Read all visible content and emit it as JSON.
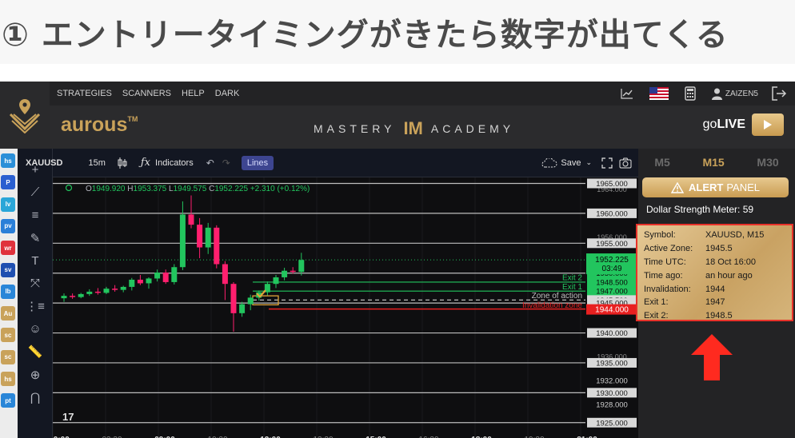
{
  "headline": {
    "text": "① エントリータイミングがきたら数字が出てくる"
  },
  "topnav": {
    "items": [
      "STRATEGIES",
      "SCANNERS",
      "HELP",
      "DARK"
    ],
    "user": "ZAIZEN5",
    "icons": [
      "line-chart-icon",
      "us-flag-icon",
      "calculator-icon",
      "user-icon",
      "logout-icon"
    ]
  },
  "brand": {
    "name": "aurous",
    "tm": "TM",
    "mastery_left": "MASTERY",
    "mastery_mid": "IM",
    "mastery_right": "ACADEMY",
    "golive_prefix": "go",
    "golive_bold": "LIVE"
  },
  "leftstrip": {
    "items": [
      {
        "label": "hs",
        "color": "#2b8fd8"
      },
      {
        "label": "P",
        "color": "#2a5fd0"
      },
      {
        "label": "lv",
        "color": "#2aa6d8"
      },
      {
        "label": "pv",
        "color": "#2a7fd8"
      },
      {
        "label": "wr",
        "color": "#e0323c"
      },
      {
        "label": "sv",
        "color": "#1f4fb0"
      },
      {
        "label": "lb",
        "color": "#2a86d8"
      },
      {
        "label": "Au",
        "color": "#c9a25a"
      },
      {
        "label": "sc",
        "color": "#c9a25a"
      },
      {
        "label": "sc",
        "color": "#c9a25a"
      },
      {
        "label": "hs",
        "color": "#c9a25a"
      },
      {
        "label": "pt",
        "color": "#2a86d8"
      }
    ]
  },
  "tools": [
    "+",
    "⟋",
    "≡",
    "✎",
    "T",
    "⤧",
    "⋮≡",
    "☺",
    "📏",
    "⊕",
    "⋂"
  ],
  "charttb": {
    "symbol": "XAUUSD",
    "timeframe": "15m",
    "indicators": "Indicators",
    "lines": "Lines",
    "save": "Save"
  },
  "ohlc": {
    "o_label": "O",
    "o": "1949.920",
    "h_label": "H",
    "h": "1953.375",
    "l_label": "L",
    "l": "1949.575",
    "c_label": "C",
    "c": "1952.225",
    "change": "+2.310 (+0.12%)"
  },
  "chart_data": {
    "type": "candlestick",
    "symbol": "XAUUSD",
    "interval": "15m",
    "ylim": [
      1923.5,
      1966
    ],
    "candles": [
      [
        1945.8,
        1946.6,
        1945.2,
        1946.2
      ],
      [
        1946.2,
        1946.6,
        1945.7,
        1946.0
      ],
      [
        1946.0,
        1946.7,
        1945.8,
        1946.5
      ],
      [
        1946.5,
        1947.3,
        1946.2,
        1946.9
      ],
      [
        1946.9,
        1947.5,
        1946.4,
        1946.7
      ],
      [
        1946.7,
        1947.7,
        1946.5,
        1947.4
      ],
      [
        1947.4,
        1948.0,
        1946.9,
        1947.2
      ],
      [
        1947.2,
        1947.9,
        1946.8,
        1947.7
      ],
      [
        1947.7,
        1949.2,
        1947.1,
        1948.9
      ],
      [
        1948.9,
        1949.7,
        1948.0,
        1948.3
      ],
      [
        1948.3,
        1949.3,
        1947.4,
        1949.1
      ],
      [
        1949.1,
        1950.6,
        1948.6,
        1950.1
      ],
      [
        1950.1,
        1950.6,
        1948.2,
        1948.5
      ],
      [
        1948.5,
        1951.5,
        1948.1,
        1951.0
      ],
      [
        1951.0,
        1962.0,
        1950.5,
        1959.8
      ],
      [
        1959.8,
        1963.0,
        1957.5,
        1958.1
      ],
      [
        1958.1,
        1959.2,
        1952.5,
        1954.3
      ],
      [
        1954.3,
        1958.4,
        1953.2,
        1957.6
      ],
      [
        1957.6,
        1958.0,
        1950.8,
        1951.5
      ],
      [
        1951.5,
        1952.0,
        1945.5,
        1948.2
      ],
      [
        1948.2,
        1948.5,
        1940.2,
        1943.3
      ],
      [
        1943.3,
        1945.2,
        1942.7,
        1944.8
      ],
      [
        1944.8,
        1946.4,
        1943.8,
        1945.9
      ],
      [
        1945.9,
        1947.1,
        1945.4,
        1946.8
      ],
      [
        1946.8,
        1948.6,
        1946.3,
        1948.2
      ],
      [
        1948.2,
        1949.7,
        1947.5,
        1949.3
      ],
      [
        1949.3,
        1950.9,
        1948.8,
        1950.4
      ],
      [
        1950.4,
        1951.0,
        1949.9,
        1950.2
      ],
      [
        1950.2,
        1953.4,
        1949.6,
        1952.2
      ]
    ],
    "price_labels": [
      "1965.000",
      "1960.000",
      "1955.000",
      "1950.000",
      "1948.500",
      "1947.000",
      "1945.500",
      "1945.000",
      "1940.000",
      "1935.000",
      "1932.000",
      "1930.000",
      "1928.000",
      "1925.000"
    ],
    "faded_labels": [
      "1964.000",
      "1956.000",
      "1936.000"
    ],
    "current_price": "1952.225",
    "current_time": "03:49",
    "invalidation_label": "1944.000",
    "exit2_label": "Exit 2",
    "exit1_label": "Exit 1",
    "zone_label": "Zone of action",
    "invalidation_zone_label": "Invalidation zone",
    "x_labels": [
      "00:00",
      "03:30",
      "09:00",
      "10:30",
      "12:00",
      "13:30",
      "15:00",
      "16:30",
      "18:00",
      "19:30",
      "21:00"
    ],
    "colors": {
      "up": "#22c55e",
      "down": "#ff1f6e"
    }
  },
  "rpanel": {
    "tabs": [
      "M5",
      "M15",
      "M30"
    ],
    "alert_word": "ALERT",
    "alert_rest": "PANEL",
    "dsm": "Dollar Strength Meter: 59",
    "info": [
      {
        "k": "Symbol:",
        "v": "XAUUSD, M15"
      },
      {
        "k": "Active Zone:",
        "v": "1945.5"
      },
      {
        "k": "Time UTC:",
        "v": "18 Oct 16:00"
      },
      {
        "k": "Time ago:",
        "v": "an hour ago"
      },
      {
        "k": "Invalidation:",
        "v": "1944"
      },
      {
        "k": "Exit 1:",
        "v": "1947"
      },
      {
        "k": "Exit 2:",
        "v": "1948.5"
      }
    ]
  }
}
